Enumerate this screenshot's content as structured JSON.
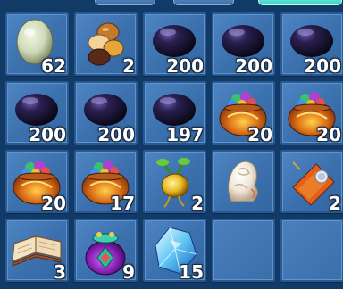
{
  "inventory": {
    "slots": [
      {
        "icon": "pale-egg-icon",
        "qty": "62"
      },
      {
        "icon": "brown-gems-icon",
        "qty": "2"
      },
      {
        "icon": "dark-orb-icon",
        "qty": "200"
      },
      {
        "icon": "dark-orb-icon",
        "qty": "200"
      },
      {
        "icon": "dark-orb-icon",
        "qty": "200"
      },
      {
        "icon": "dark-orb-icon",
        "qty": "200"
      },
      {
        "icon": "dark-orb-icon",
        "qty": "200"
      },
      {
        "icon": "dark-orb-icon",
        "qty": "197"
      },
      {
        "icon": "treasure-bag-icon",
        "qty": "20"
      },
      {
        "icon": "treasure-bag-icon",
        "qty": "20"
      },
      {
        "icon": "treasure-bag-icon",
        "qty": "20"
      },
      {
        "icon": "treasure-bag-icon",
        "qty": "17"
      },
      {
        "icon": "golden-root-icon",
        "qty": "2"
      },
      {
        "icon": "white-spirit-figurine-icon",
        "qty": ""
      },
      {
        "icon": "orange-pouch-icon",
        "qty": "2"
      },
      {
        "icon": "open-book-icon",
        "qty": "3"
      },
      {
        "icon": "purple-pouch-icon",
        "qty": "9"
      },
      {
        "icon": "blue-crystal-icon",
        "qty": "15"
      },
      {
        "icon": "",
        "qty": ""
      },
      {
        "icon": "",
        "qty": ""
      }
    ]
  }
}
